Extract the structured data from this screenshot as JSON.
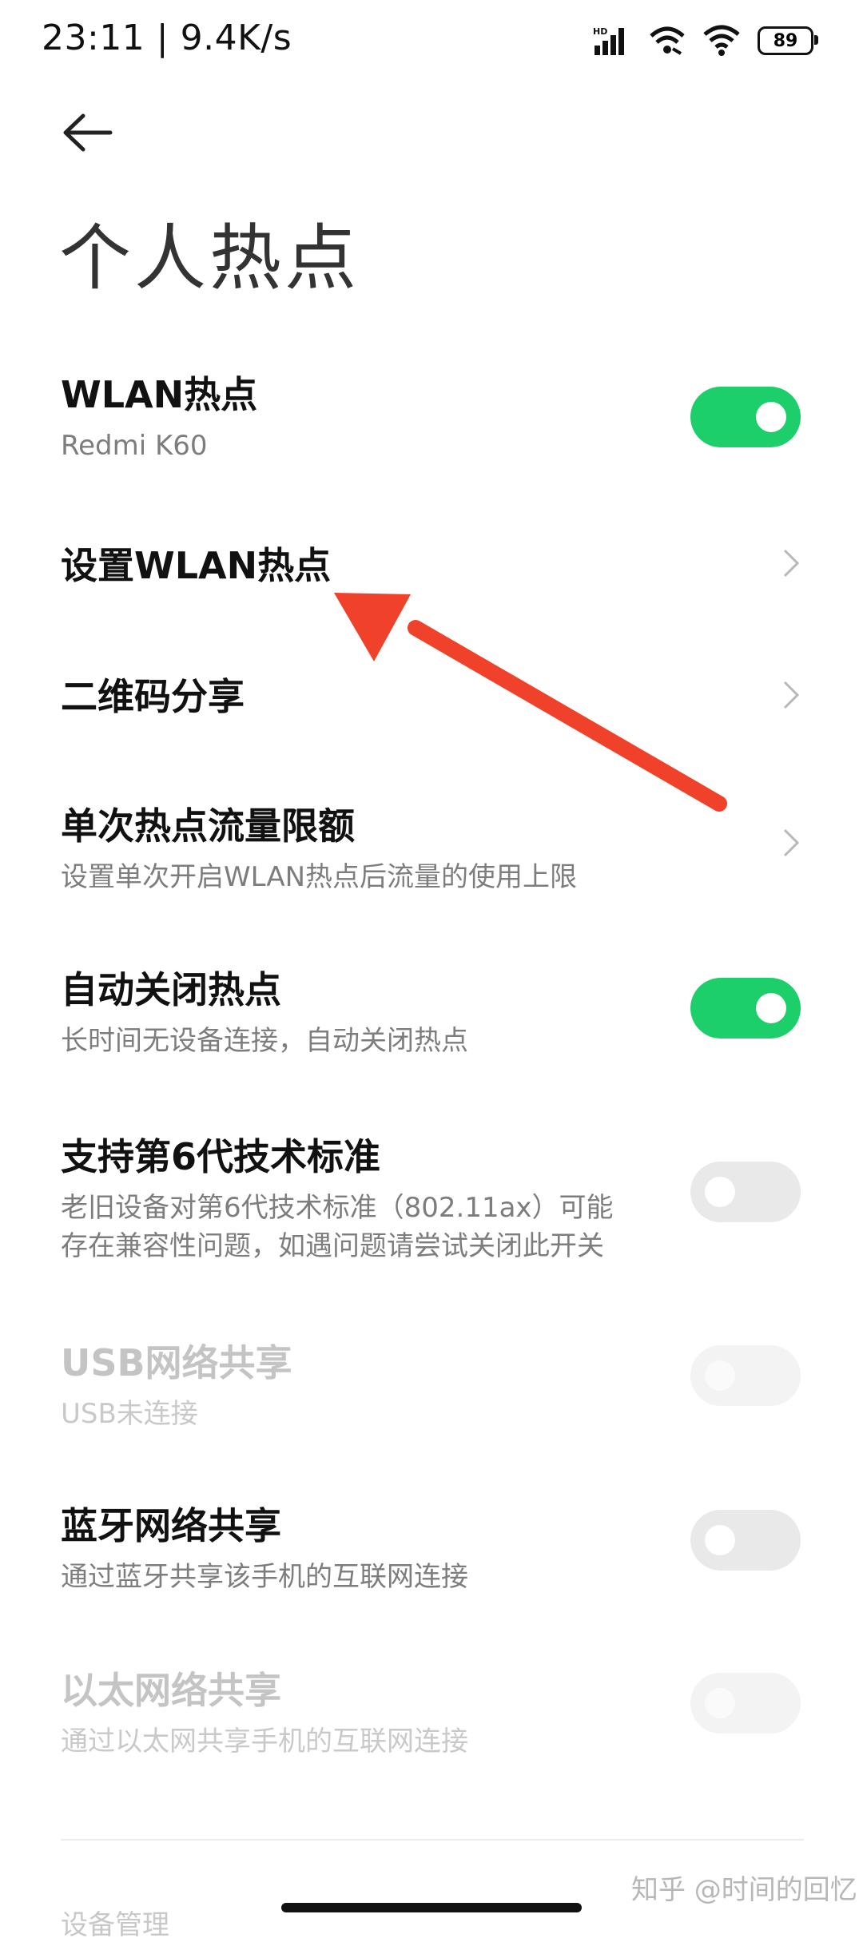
{
  "status_bar": {
    "time": "23:11 | 9.4K/s",
    "battery": "89",
    "icons": [
      "hd-signal-icon",
      "wifi-calling-icon",
      "wifi-icon",
      "battery-icon"
    ]
  },
  "header": {
    "back_icon": "arrow-left-icon",
    "title": "个人热点"
  },
  "items": [
    {
      "title": "WLAN热点",
      "subtitle": "Redmi K60",
      "control": "toggle",
      "state": "on",
      "enabled": true
    },
    {
      "title": "设置WLAN热点",
      "control": "chevron",
      "enabled": true
    },
    {
      "title": "二维码分享",
      "control": "chevron",
      "enabled": true
    },
    {
      "title": "单次热点流量限额",
      "subtitle": "设置单次开启WLAN热点后流量的使用上限",
      "control": "chevron",
      "enabled": true
    },
    {
      "title": "自动关闭热点",
      "subtitle": "长时间无设备连接，自动关闭热点",
      "control": "toggle",
      "state": "on",
      "enabled": true
    },
    {
      "title": "支持第6代技术标准",
      "subtitle_lines": [
        "老旧设备对第6代技术标准（802.11ax）可能",
        "存在兼容性问题，如遇问题请尝试关闭此开关"
      ],
      "control": "toggle",
      "state": "off",
      "enabled": true
    },
    {
      "title": "USB网络共享",
      "subtitle": "USB未连接",
      "control": "toggle",
      "state": "off",
      "enabled": false
    },
    {
      "title": "蓝牙网络共享",
      "subtitle": "通过蓝牙共享该手机的互联网连接",
      "control": "toggle",
      "state": "off",
      "enabled": true
    },
    {
      "title": "以太网络共享",
      "subtitle": "通过以太网共享手机的互联网连接",
      "control": "toggle",
      "state": "off",
      "enabled": false
    }
  ],
  "footer": {
    "section_peek": "设备管理",
    "watermark": "知乎 @时间的回忆"
  },
  "colors": {
    "toggle_on": "#1dcf6a",
    "annotation_arrow": "#f0412a"
  }
}
